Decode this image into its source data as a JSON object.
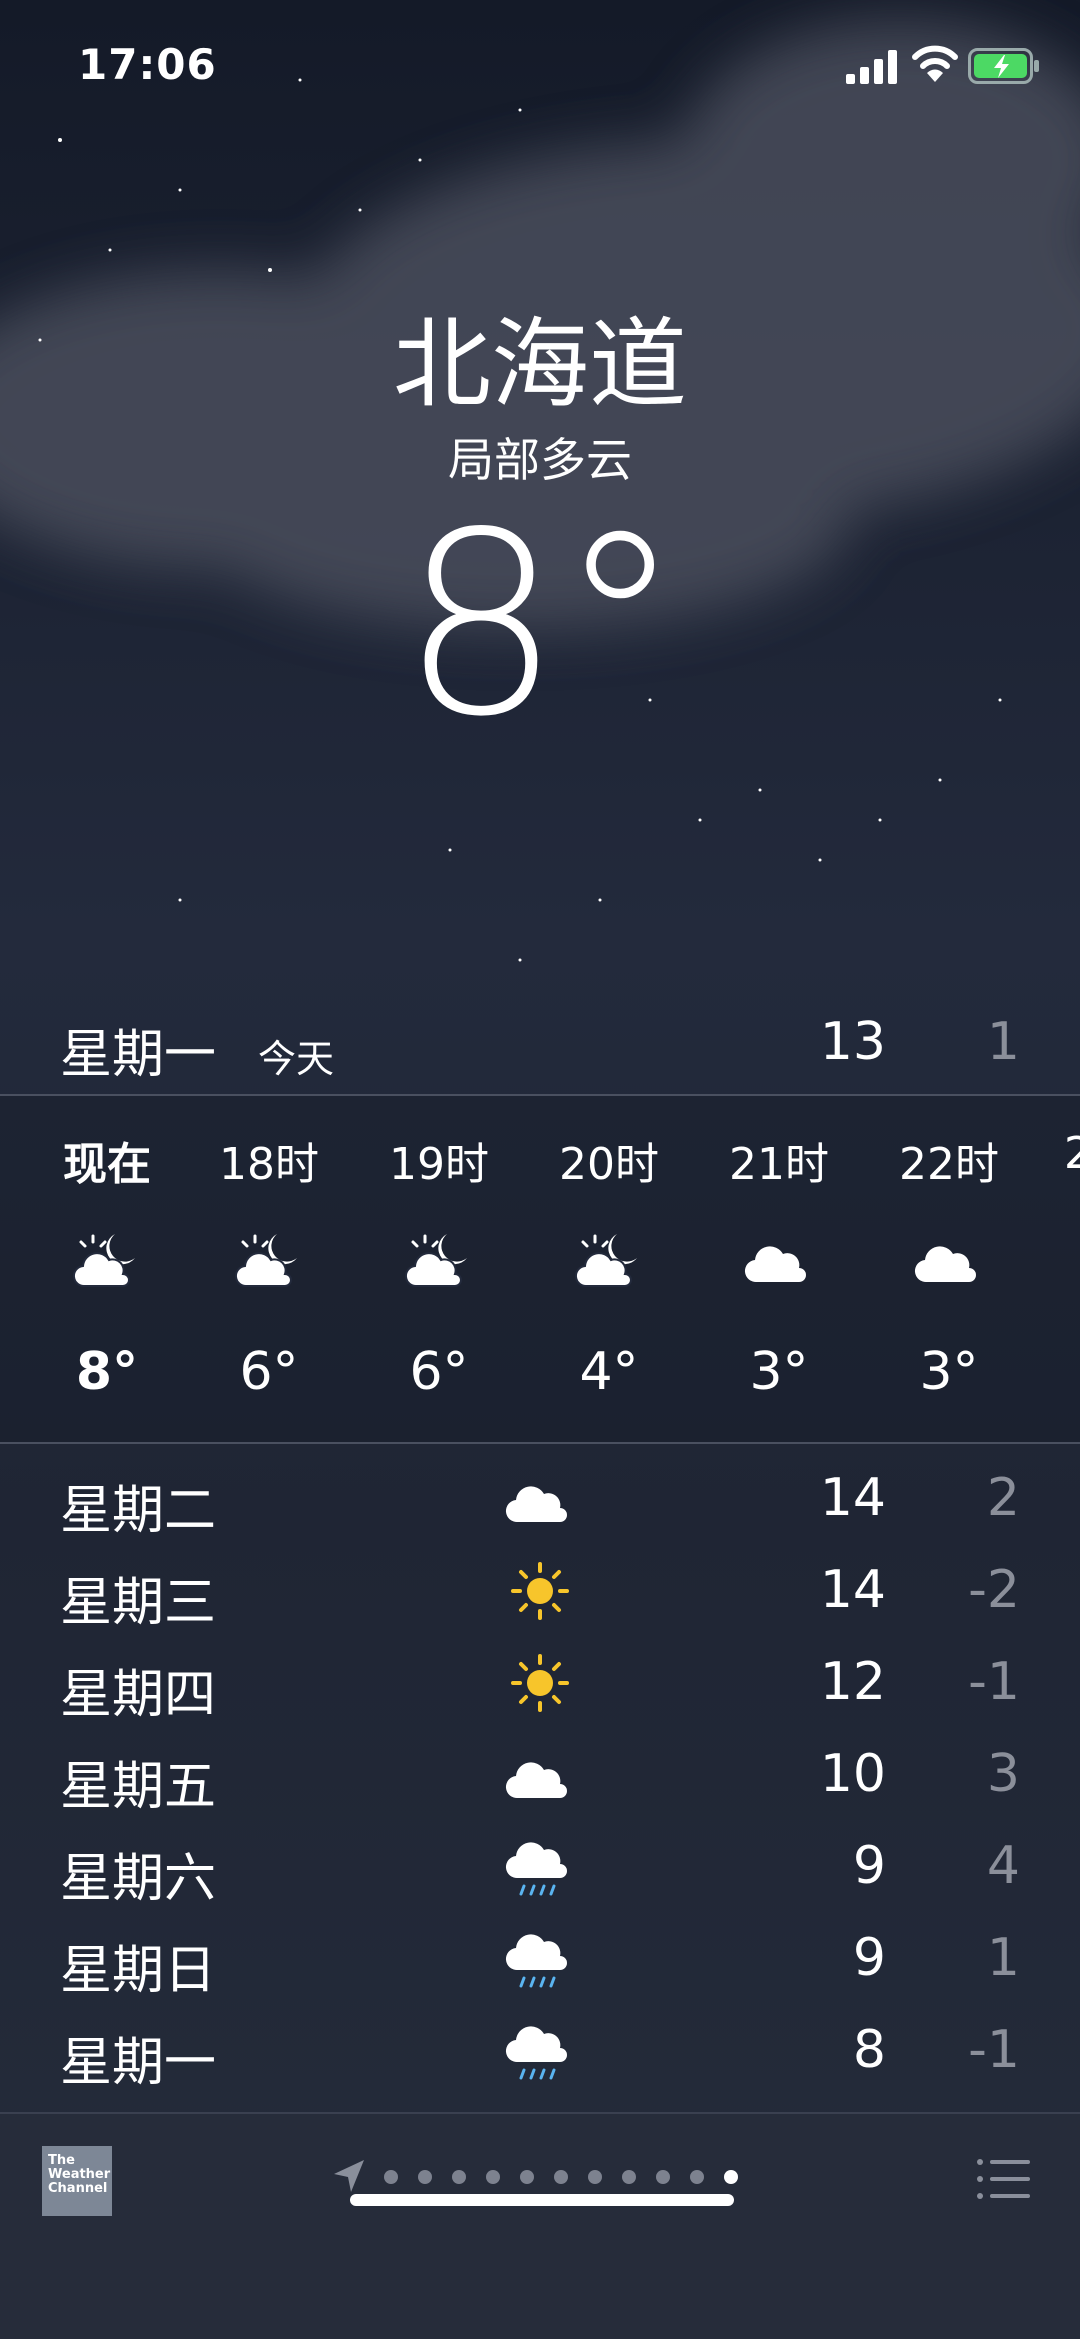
{
  "status_bar": {
    "time": "17:06",
    "signal_icon": "cellular-signal-icon",
    "wifi_icon": "wifi-icon",
    "battery_icon": "battery-charging-icon"
  },
  "current": {
    "city": "北海道",
    "condition": "局部多云",
    "temperature": "8°"
  },
  "today": {
    "day": "星期一",
    "tag": "今天",
    "high": "13",
    "low": "1"
  },
  "hourly": [
    {
      "label": "现在",
      "icon": "partly-cloudy-night-icon",
      "temp": "8°"
    },
    {
      "label": "18时",
      "icon": "partly-cloudy-night-icon",
      "temp": "6°"
    },
    {
      "label": "19时",
      "icon": "partly-cloudy-night-icon",
      "temp": "6°"
    },
    {
      "label": "20时",
      "icon": "partly-cloudy-night-icon",
      "temp": "4°"
    },
    {
      "label": "21时",
      "icon": "cloud-icon",
      "temp": "3°"
    },
    {
      "label": "22时",
      "icon": "cloud-icon",
      "temp": "3°"
    },
    {
      "label": "2",
      "icon": "",
      "temp": ""
    }
  ],
  "daily": [
    {
      "day": "星期二",
      "icon": "cloud-icon",
      "high": "14",
      "low": "2"
    },
    {
      "day": "星期三",
      "icon": "sun-icon",
      "high": "14",
      "low": "-2"
    },
    {
      "day": "星期四",
      "icon": "sun-icon",
      "high": "12",
      "low": "-1"
    },
    {
      "day": "星期五",
      "icon": "cloud-icon",
      "high": "10",
      "low": "3"
    },
    {
      "day": "星期六",
      "icon": "rain-icon",
      "high": "9",
      "low": "4"
    },
    {
      "day": "星期日",
      "icon": "rain-icon",
      "high": "9",
      "low": "1"
    },
    {
      "day": "星期一",
      "icon": "rain-icon",
      "high": "8",
      "low": "-1"
    }
  ],
  "footer": {
    "weather_channel_logo": "The Weather Channel",
    "page_count": 11,
    "active_page": 11,
    "location_icon": "location-arrow-icon",
    "list_icon": "list-icon"
  },
  "colors": {
    "sun": "#f7c52b",
    "rain": "#5ab4f0",
    "secondary_text": "#8b8f9a"
  }
}
